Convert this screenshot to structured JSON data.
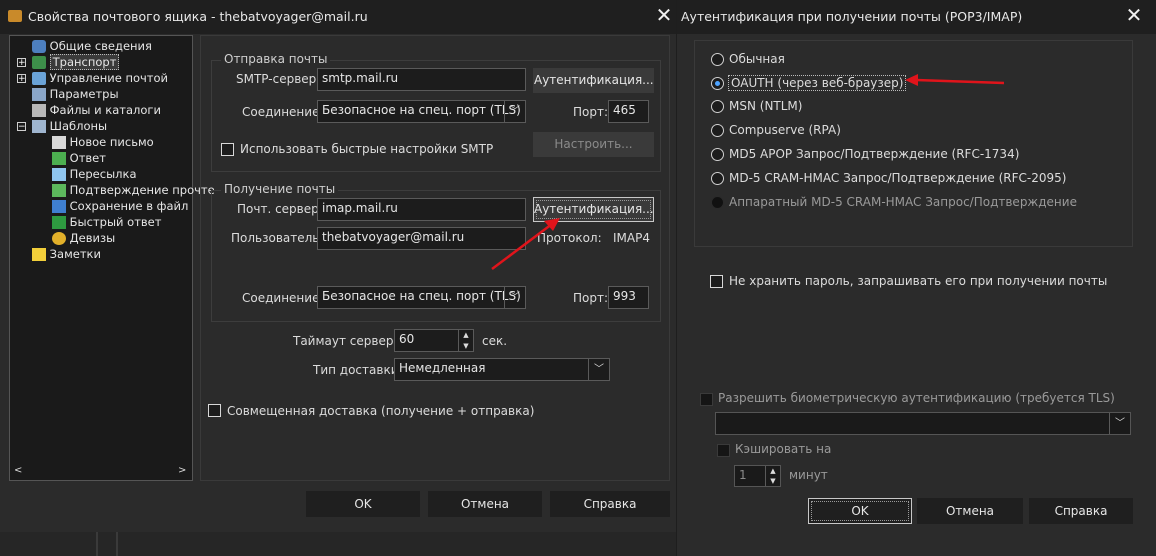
{
  "left": {
    "title": "Свойства почтового ящика - thebatvoyager@mail.ru",
    "close": "✕",
    "tree": [
      {
        "label": "Общие сведения",
        "icon": "general-icon"
      },
      {
        "label": "Транспорт",
        "icon": "transport-icon"
      },
      {
        "label": "Управление почтой",
        "icon": "mail-management-icon"
      },
      {
        "label": "Параметры",
        "icon": "parameters-icon"
      },
      {
        "label": "Файлы и каталоги",
        "icon": "files-icon"
      },
      {
        "label": "Шаблоны",
        "icon": "templates-icon"
      },
      {
        "label": "Новое письмо",
        "icon": "new-letter-icon"
      },
      {
        "label": "Ответ",
        "icon": "reply-icon"
      },
      {
        "label": "Пересылка",
        "icon": "forward-icon"
      },
      {
        "label": "Подтверждение прочте",
        "icon": "read-confirm-icon"
      },
      {
        "label": "Сохранение в файл",
        "icon": "save-file-icon"
      },
      {
        "label": "Быстрый ответ",
        "icon": "quick-reply-icon"
      },
      {
        "label": "Девизы",
        "icon": "mottos-icon"
      },
      {
        "label": "Заметки",
        "icon": "notes-icon"
      }
    ],
    "send": {
      "group_title": "Отправка почты",
      "smtp_label": "SMTP-сервер:",
      "smtp_value": "smtp.mail.ru",
      "auth_button": "Аутентификация...",
      "conn_label": "Соединение:",
      "conn_value": "Безопасное на спец. порт (TLS)",
      "port_label": "Порт:",
      "port_value": "465",
      "quick_smtp": "Использовать быстрые настройки SMTP",
      "setup_button": "Настроить..."
    },
    "receive": {
      "group_title": "Получение почты",
      "server_label": "Почт. сервер:",
      "server_value": "imap.mail.ru",
      "auth_button": "Аутентификация...",
      "user_label": "Пользователь:",
      "user_value": "thebatvoyager@mail.ru",
      "protocol_label": "Протокол:",
      "protocol_value": "IMAP4",
      "conn_label": "Соединение:",
      "conn_value": "Безопасное на спец. порт (TLS)",
      "port_label": "Порт:",
      "port_value": "993"
    },
    "timeout_label": "Таймаут сервера:",
    "timeout_value": "60",
    "timeout_unit": "сек.",
    "delivery_label": "Тип доставки:",
    "delivery_value": "Немедленная",
    "combined": "Совмещенная доставка (получение + отправка)",
    "ok": "OK",
    "cancel": "Отмена",
    "help": "Справка"
  },
  "right": {
    "title": "Аутентификация при получении почты (POP3/IMAP)",
    "close": "✕",
    "options": [
      {
        "label": "Обычная",
        "checked": false,
        "disabled": false
      },
      {
        "label": "OAUTH (через веб-браузер)",
        "checked": true,
        "disabled": false
      },
      {
        "label": "MSN (NTLM)",
        "checked": false,
        "disabled": false
      },
      {
        "label": "Compuserve (RPA)",
        "checked": false,
        "disabled": false
      },
      {
        "label": "MD5 APOP Запрос/Подтверждение (RFC-1734)",
        "checked": false,
        "disabled": false
      },
      {
        "label": "MD-5 CRAM-HMAC Запрос/Подтверждение (RFC-2095)",
        "checked": false,
        "disabled": false
      },
      {
        "label": "Аппаратный MD-5 CRAM-HMAC Запрос/Подтверждение",
        "checked": false,
        "disabled": true
      }
    ],
    "no_save_password": "Не хранить пароль, запрашивать его при получении почты",
    "biometric": "Разрешить биометрическую аутентификацию (требуется TLS)",
    "cache_label": "Кэшировать на",
    "cache_value": "1",
    "cache_unit": "минут",
    "ok": "OK",
    "cancel": "Отмена",
    "help": "Справка"
  },
  "colors": {
    "accent": "#4da3ff",
    "arrow": "#e0141b"
  }
}
